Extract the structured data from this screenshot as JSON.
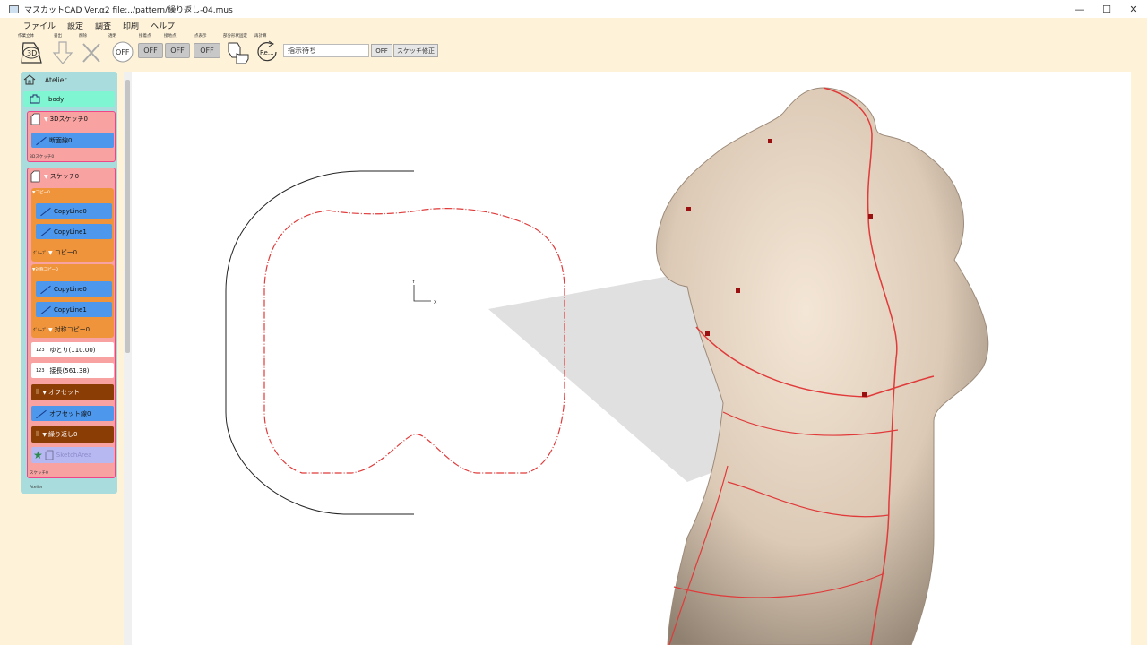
{
  "window": {
    "title": "マスカットCAD Ver.α2 file:../pattern/繰り返し-04.mus",
    "minimize": "—",
    "maximize": "☐",
    "close": "✕"
  },
  "menu": [
    "ファイル",
    "設定",
    "調査",
    "印刷",
    "ヘルプ"
  ],
  "toolbar": {
    "tools": [
      {
        "label": "作業立体",
        "icon": "3d-sketch-icon",
        "text": "3D"
      },
      {
        "label": "書出",
        "icon": "down-arrow-icon"
      },
      {
        "label": "削除",
        "icon": "delete-x-icon"
      },
      {
        "label": "透明",
        "icon": "transparency-icon",
        "text": "OFF"
      }
    ],
    "toggles": [
      {
        "label": "接着点",
        "value": "OFF"
      },
      {
        "label": "接地点",
        "value": "OFF"
      },
      {
        "label": "点表示",
        "value": "OFF"
      }
    ],
    "cursor_label": "部分形状固定",
    "refresh_label": "再計算",
    "refresh_text": "Re...",
    "status_input": "指示待ち",
    "status_off": "OFF",
    "sketch_fix": "スケッチ修正"
  },
  "panel": {
    "home": "Atelier",
    "body": "body",
    "sketch3d": {
      "title": "3Dスケッチ0",
      "child": "断面線0",
      "footer": "3Dスケッチ0"
    },
    "sketch": {
      "title": "スケッチ0",
      "copy_group": {
        "header": "コピー0",
        "items": [
          "CopyLine0",
          "CopyLine1"
        ],
        "footer_prefix": "ｸﾞﾙｰﾌﾟ",
        "footer": "コピー0"
      },
      "sym_group": {
        "header": "対称コピー0",
        "items": [
          "CopyLine0",
          "CopyLine1"
        ],
        "footer_prefix": "ｸﾞﾙｰﾌﾟ",
        "footer": "対称コピー0"
      },
      "params": [
        {
          "badge": "123",
          "label": "ゆとり(110.00)"
        },
        {
          "badge": "123",
          "label": "接長(561.38)"
        }
      ],
      "offset": "オフセット",
      "offset_line": "オフセット線0",
      "repeat": "繰り返し0",
      "sketch_area": "SketchArea",
      "footer": "スケッチ0"
    },
    "footer": "Atelier"
  },
  "canvas": {
    "axis_x": "X",
    "axis_y": "Y",
    "colors": {
      "pattern": "#e03a3a",
      "outline": "#222222",
      "skin": "#dccab8",
      "plane": "#cfcfcf"
    }
  }
}
